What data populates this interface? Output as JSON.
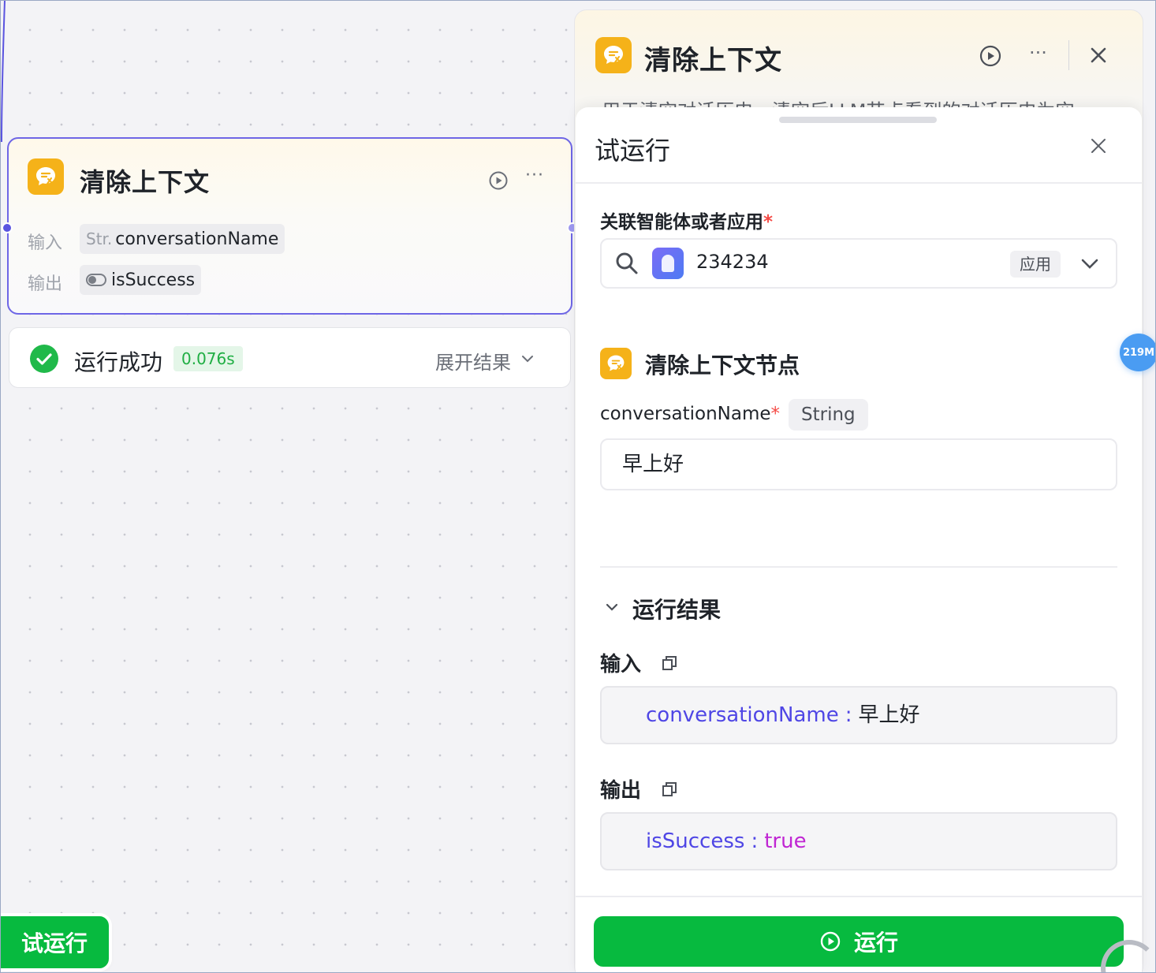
{
  "canvas": {
    "node": {
      "title": "清除上下文",
      "input_label": "输入",
      "input_type": "Str.",
      "input_value": "conversationName",
      "output_label": "输出",
      "output_value": "isSuccess",
      "icon": "clear-context-icon"
    },
    "run_status": {
      "text": "运行成功",
      "time": "0.076s",
      "expand_label": "展开结果"
    },
    "try_run_label": "试运行"
  },
  "side_panel": {
    "title": "清除上下文",
    "description": "用于清空对话历史，清空后LLM节点看到的对话历史为空"
  },
  "test_run": {
    "title": "试运行",
    "agent_label": "关联智能体或者应用",
    "agent_required_mark": "*",
    "agent_value": "234234",
    "agent_tag": "应用",
    "node_section_title": "清除上下文节点",
    "param_name": "conversationName",
    "param_required_mark": "*",
    "param_type": "String",
    "param_value": "早上好",
    "result_title": "运行结果",
    "input_label": "输入",
    "input_key": "conversationName",
    "input_sep": ":",
    "input_value": "早上好",
    "output_label": "输出",
    "output_key": "isSuccess",
    "output_sep": ":",
    "output_value": "true",
    "run_button": "运行"
  },
  "memory_badge": "219M",
  "colors": {
    "accent_green": "#07ba3f",
    "node_border": "#6e66e6",
    "node_icon_bg": "#f5b219",
    "code_key": "#4f46e5",
    "code_bool": "#c026d3"
  }
}
